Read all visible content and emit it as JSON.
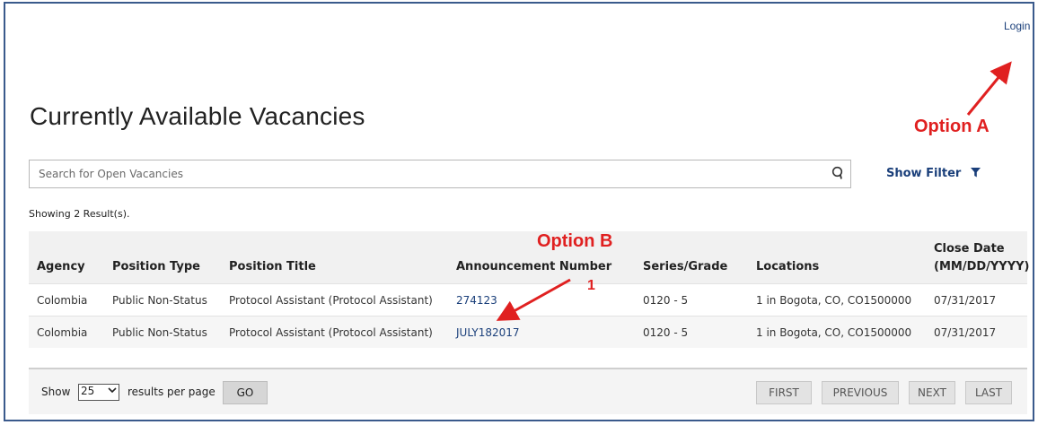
{
  "header": {
    "login_label": "Login"
  },
  "page": {
    "title": "Currently Available Vacancies"
  },
  "search": {
    "placeholder": "Search for Open Vacancies",
    "icon": "search-icon"
  },
  "filter": {
    "label": "Show Filter",
    "icon": "filter-icon"
  },
  "results": {
    "count_text": "Showing 2 Result(s)."
  },
  "table": {
    "columns": [
      "Agency",
      "Position Type",
      "Position Title",
      "Announcement Number",
      "Series/Grade",
      "Locations",
      "Close Date",
      "(MM/DD/YYYY)"
    ],
    "rows": [
      {
        "agency": "Colombia",
        "position_type": "Public Non-Status",
        "position_title": "Protocol Assistant (Protocol Assistant)",
        "announcement_number": "274123",
        "series_grade": "0120 - 5",
        "locations": "1 in Bogota, CO, CO1500000",
        "close_date": "07/31/2017"
      },
      {
        "agency": "Colombia",
        "position_type": "Public Non-Status",
        "position_title": "Protocol Assistant (Protocol Assistant)",
        "announcement_number": "JULY182017",
        "series_grade": "0120 - 5",
        "locations": "1 in Bogota, CO, CO1500000",
        "close_date": "07/31/2017"
      }
    ]
  },
  "footer": {
    "show_label": "Show",
    "per_page_value": "25",
    "per_page_label": "results per page",
    "go_label": "GO",
    "pagination": {
      "first": "FIRST",
      "previous": "PREVIOUS",
      "next": "NEXT",
      "last": "LAST"
    }
  },
  "annotations": {
    "option_a": "Option A",
    "option_b": "Option B",
    "step_1": "1",
    "color": "#e02020"
  },
  "colors": {
    "link": "#1a3f7a",
    "frame_border": "#3a5a8c",
    "header_bg": "#f1f1f1"
  }
}
